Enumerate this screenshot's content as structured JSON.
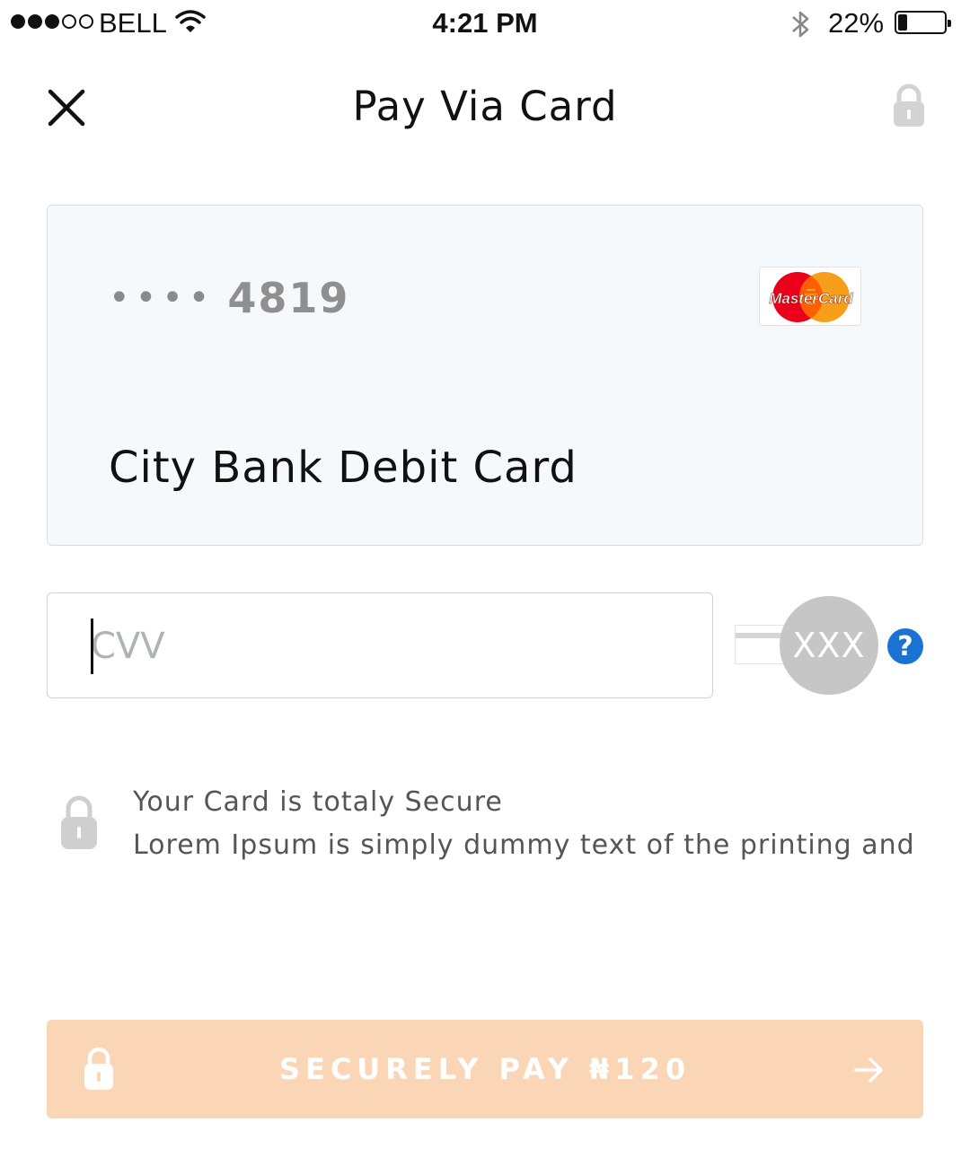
{
  "status_bar": {
    "carrier": "BELL",
    "time": "4:21 PM",
    "battery": "22%",
    "signal_bars": 3,
    "battery_level": 0.22,
    "icons": [
      "signal-dots",
      "wifi-icon",
      "bluetooth-icon",
      "battery-icon"
    ]
  },
  "header": {
    "title": "Pay Via Card",
    "close_icon": "close-icon",
    "lock_icon": "lock-icon"
  },
  "card": {
    "masked_dots": "••••",
    "last4": "4819",
    "name": "City Bank Debit Card",
    "brand": "MasterCard",
    "brand_colors": {
      "red": "#eb001b",
      "orange": "#f79e1b"
    },
    "background": "#f6f9fc"
  },
  "cvv": {
    "placeholder": "CVV",
    "value": "",
    "hint_text": "XXX",
    "help_icon": "question-circle-icon",
    "help_color": "#1a73d2"
  },
  "security_note": {
    "title": "Your Card is totaly Secure",
    "description": "Lorem Ipsum is simply dummy text of the printing and"
  },
  "pay_button": {
    "label": "SECURELY PAY ₦120",
    "background": "#fad5b6",
    "lock_icon": "lock-icon",
    "arrow_icon": "arrow-right-icon"
  }
}
